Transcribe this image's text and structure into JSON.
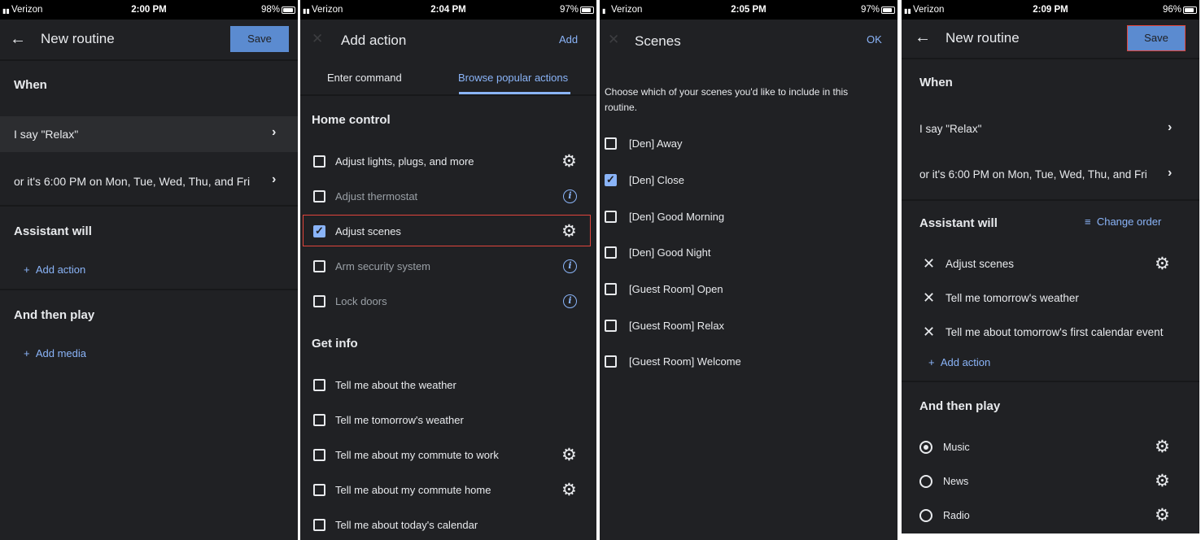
{
  "screen1": {
    "status": {
      "carrier": "Verizon",
      "time": "2:00 PM",
      "battery": "98%"
    },
    "title": "New routine",
    "save_label": "Save",
    "when_label": "When",
    "triggers": [
      "I say \"Relax\"",
      "or it's 6:00 PM on Mon, Tue, Wed, Thu, and Fri"
    ],
    "assistant_label": "Assistant will",
    "add_action": "Add action",
    "then_play_label": "And then play",
    "add_media": "Add media"
  },
  "screen2": {
    "status": {
      "carrier": "Verizon",
      "time": "2:04 PM",
      "battery": "97%"
    },
    "title": "Add action",
    "add_label": "Add",
    "tabs": [
      "Enter command",
      "Browse popular actions"
    ],
    "active_tab": 1,
    "home_control_label": "Home control",
    "home_items": [
      {
        "label": "Adjust lights, plugs, and more",
        "checked": false,
        "icon": "gear-icon"
      },
      {
        "label": "Adjust thermostat",
        "checked": false,
        "icon": "info-icon"
      },
      {
        "label": "Adjust scenes",
        "checked": true,
        "icon": "gear-icon"
      },
      {
        "label": "Arm security system",
        "checked": false,
        "icon": "info-icon"
      },
      {
        "label": "Lock doors",
        "checked": false,
        "icon": "info-icon"
      }
    ],
    "get_info_label": "Get info",
    "info_items": [
      {
        "label": "Tell me about the weather",
        "checked": false,
        "icon": ""
      },
      {
        "label": "Tell me tomorrow's weather",
        "checked": false,
        "icon": ""
      },
      {
        "label": "Tell me about my commute to work",
        "checked": false,
        "icon": "gear-icon"
      },
      {
        "label": "Tell me about my commute home",
        "checked": false,
        "icon": "gear-icon"
      },
      {
        "label": "Tell me about today's calendar",
        "checked": false,
        "icon": ""
      }
    ]
  },
  "screen3": {
    "status": {
      "carrier": "Verizon",
      "time": "2:05 PM",
      "battery": "97%"
    },
    "title": "Scenes",
    "ok_label": "OK",
    "description": "Choose which of your scenes you'd like to include in this routine.",
    "scenes": [
      {
        "label": "[Den] Away",
        "checked": false
      },
      {
        "label": "[Den] Close",
        "checked": true
      },
      {
        "label": "[Den] Good Morning",
        "checked": false
      },
      {
        "label": "[Den] Good Night",
        "checked": false
      },
      {
        "label": "[Guest Room] Open",
        "checked": false
      },
      {
        "label": "[Guest Room] Relax",
        "checked": false
      },
      {
        "label": "[Guest Room] Welcome",
        "checked": false
      }
    ]
  },
  "screen4": {
    "status": {
      "carrier": "Verizon",
      "time": "2:09 PM",
      "battery": "96%"
    },
    "title": "New routine",
    "save_label": "Save",
    "when_label": "When",
    "triggers": [
      "I say \"Relax\"",
      "or it's 6:00 PM on Mon, Tue, Wed, Thu, and Fri"
    ],
    "assistant_label": "Assistant will",
    "change_order": "Change order",
    "actions": [
      {
        "label": "Adjust scenes",
        "icon": "gear-icon"
      },
      {
        "label": "Tell me tomorrow's weather",
        "icon": ""
      },
      {
        "label": "Tell me about tomorrow's first calendar event",
        "icon": ""
      }
    ],
    "add_action": "Add action",
    "then_play_label": "And then play",
    "media": [
      {
        "label": "Music",
        "selected": true
      },
      {
        "label": "News",
        "selected": false
      },
      {
        "label": "Radio",
        "selected": false
      }
    ]
  },
  "colors": {
    "background": "#202124",
    "accent": "#8ab4f8",
    "save_button": "#5b8bd0",
    "highlight_border": "#e0453c"
  }
}
